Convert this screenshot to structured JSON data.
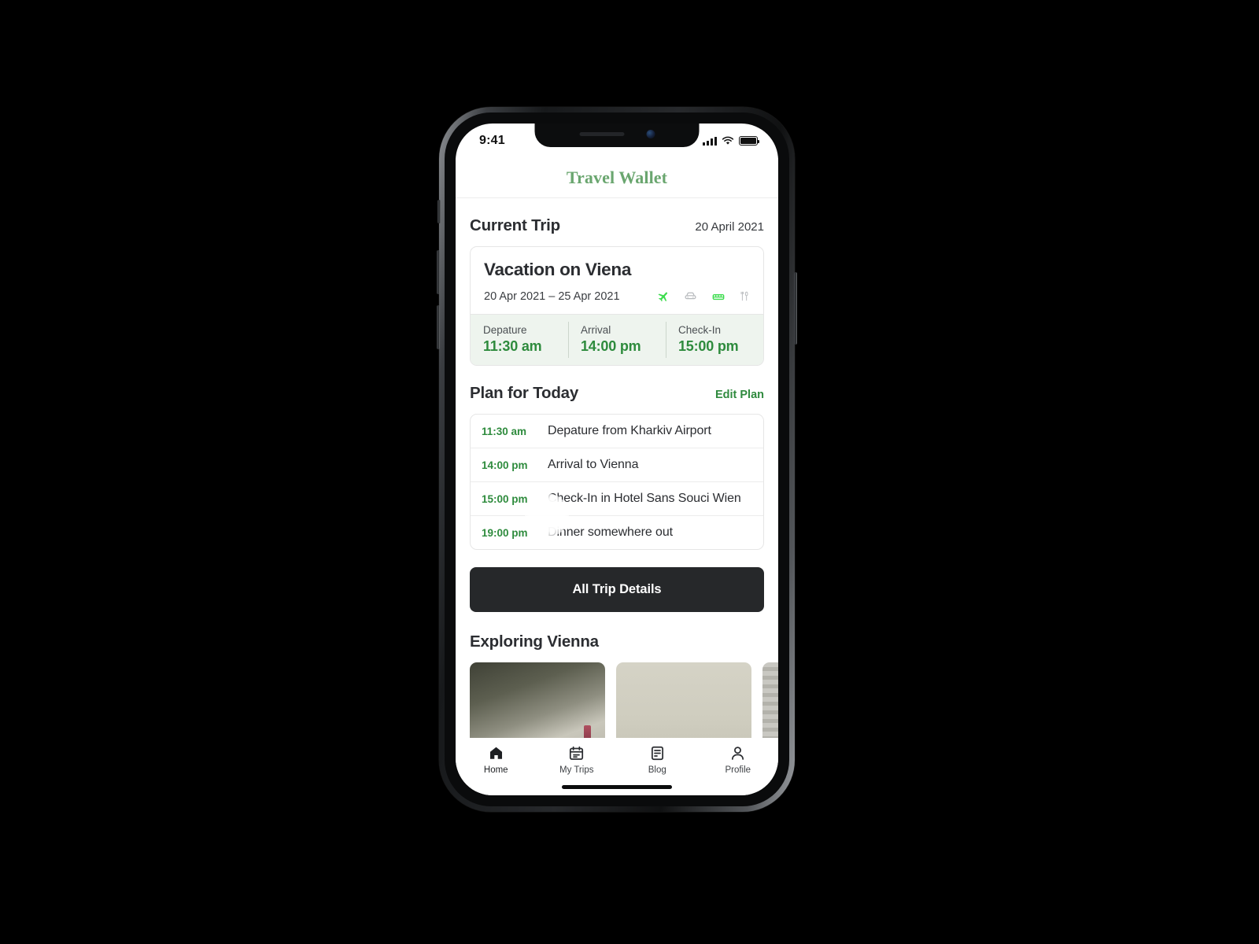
{
  "device": {
    "status_bar": {
      "time": "9:41",
      "signal_icon": "cellular-bars-icon",
      "wifi_icon": "wifi-icon",
      "battery_icon": "battery-full-icon"
    },
    "home_indicator": "home-indicator"
  },
  "header": {
    "brand": "Travel Wallet"
  },
  "current_trip": {
    "section_title": "Current Trip",
    "date": "20 April 2021",
    "name": "Vacation on Viena",
    "date_range": "20 Apr 2021 – 25 Apr 2021",
    "amenities": [
      {
        "icon": "airplane-icon",
        "active": true
      },
      {
        "icon": "car-icon",
        "active": false
      },
      {
        "icon": "bed-icon",
        "active": true
      },
      {
        "icon": "cutlery-icon",
        "active": false
      }
    ],
    "times": [
      {
        "label": "Depature",
        "value": "11:30 am"
      },
      {
        "label": "Arrival",
        "value": "14:00 pm"
      },
      {
        "label": "Check-In",
        "value": "15:00 pm"
      }
    ]
  },
  "plan": {
    "section_title": "Plan for Today",
    "edit_label": "Edit Plan",
    "items": [
      {
        "time": "11:30 am",
        "text": "Depature from Kharkiv Airport"
      },
      {
        "time": "14:00 pm",
        "text": "Arrival to Vienna"
      },
      {
        "time": "15:00 pm",
        "text": "Check-In in Hotel Sans Souci Wien"
      },
      {
        "time": "19:00 pm",
        "text": "Dinner somewhere out"
      }
    ]
  },
  "cta": {
    "label": "All Trip Details"
  },
  "explore": {
    "section_title": "Exploring Vienna",
    "cards": [
      {
        "name": "explore-card-1"
      },
      {
        "name": "explore-card-2"
      },
      {
        "name": "explore-card-3"
      }
    ]
  },
  "tabbar": {
    "items": [
      {
        "label": "Home",
        "icon": "home-icon",
        "active": true
      },
      {
        "label": "My Trips",
        "icon": "calendar-icon",
        "active": false
      },
      {
        "label": "Blog",
        "icon": "article-icon",
        "active": false
      },
      {
        "label": "Profile",
        "icon": "person-icon",
        "active": false
      }
    ]
  },
  "colors": {
    "brand_green": "#6aa66f",
    "accent_green": "#2e8b3d",
    "icon_green": "#3ddc4e",
    "dark_button": "#26282a",
    "mint_bg": "#eef4ee"
  }
}
